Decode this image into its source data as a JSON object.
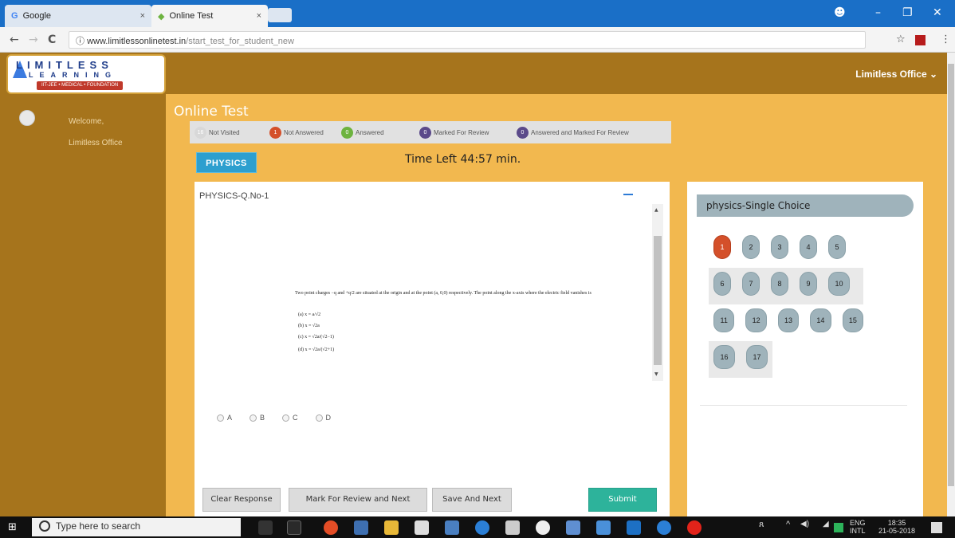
{
  "browser": {
    "tabs": [
      {
        "icon": "google-icon",
        "title": "Google",
        "close": "×"
      },
      {
        "icon": "site-icon",
        "title": "Online Test",
        "close": "×"
      }
    ],
    "controls": {
      "account": "☻",
      "minimize": "–",
      "maximize": "❐",
      "close": "✕"
    },
    "nav": {
      "back": "←",
      "forward": "→",
      "reload": "C",
      "info": "ⓘ",
      "star": "☆",
      "menu": "⋮"
    },
    "url_host": "www.limitlessonlinetest.in",
    "url_path": "/start_test_for_student_new"
  },
  "header": {
    "logo_line1": "LIMITLESS",
    "logo_line2": "LEARNING",
    "logo_line3": "IIT-JEE • MEDICAL • FOUNDATION",
    "user_menu": "Limitless Office ⌄"
  },
  "sidebar": {
    "welcome": "Welcome,",
    "user_name": "Limitless Office"
  },
  "main": {
    "page_title": "Online Test",
    "legend": [
      {
        "count": "16",
        "label": "Not Visited",
        "color": "#d8d8d8"
      },
      {
        "count": "1",
        "label": "Not Answered",
        "color": "#d4502a"
      },
      {
        "count": "0",
        "label": "Answered",
        "color": "#6db33f"
      },
      {
        "count": "0",
        "label": "Marked For Review",
        "color": "#5b4a8a"
      },
      {
        "count": "0",
        "label": "Answered and Marked For Review",
        "color": "#5b4a8a"
      }
    ],
    "subject_tab": "PHYSICS",
    "time_left": "Time Left 44:57 min."
  },
  "question": {
    "number_label": "PHYSICS-Q.No-1",
    "text": "Two point charges −q and +q/2 are situated at the origin and at the point (a, 0,0) respectively. The point along the x-axis where the electric field vanishes is",
    "options_text": [
      "(a) x = a/√2",
      "(b) x = √2a",
      "(c) x = √2a/(√2−1)",
      "(d) x = √2a/(√2+1)"
    ],
    "answer_options": [
      "A",
      "B",
      "C",
      "D"
    ]
  },
  "buttons": {
    "clear": "Clear Response",
    "mark_review": "Mark For Review and Next",
    "save_next": "Save And Next",
    "submit": "Submit"
  },
  "palette": {
    "section_title": "physics-Single Choice",
    "current": "1",
    "rows": [
      [
        "1",
        "2",
        "3",
        "4",
        "5"
      ],
      [
        "6",
        "7",
        "8",
        "9",
        "10"
      ],
      [
        "11",
        "12",
        "13",
        "14",
        "15"
      ],
      [
        "16",
        "17"
      ]
    ]
  },
  "taskbar": {
    "search_placeholder": "Type here to search",
    "lang": "ENG",
    "lang_sub": "INTL",
    "time": "18:35",
    "date": "21-05-2018"
  }
}
